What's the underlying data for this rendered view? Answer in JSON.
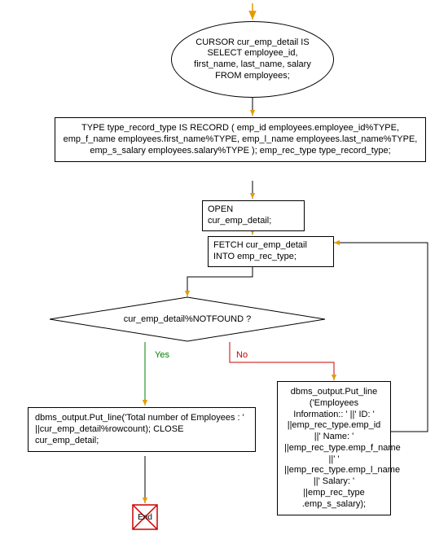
{
  "nodes": {
    "cursor": "CURSOR cur_emp_detail IS SELECT employee_id, first_name, last_name, salary FROM employees;",
    "type_record": "TYPE type_record_type IS RECORD ( emp_id employees.employee_id%TYPE, emp_f_name employees.first_name%TYPE, emp_l_name employees.last_name%TYPE, emp_s_salary employees.salary%TYPE ); emp_rec_type type_record_type;",
    "open": "OPEN cur_emp_detail;",
    "fetch": "FETCH cur_emp_detail INTO emp_rec_type;",
    "decision": "cur_emp_detail%NOTFOUND ?",
    "output_row": "dbms_output.Put_line ('Employees Information::  ' ||' ID: ' ||emp_rec_type.emp_id ||'   Name: ' ||emp_rec_type.emp_f_name ||' ' ||emp_rec_type.emp_l_name ||'   Salary: ' ||emp_rec_type .emp_s_salary);",
    "output_total": "dbms_output.Put_line('Total number of Employees : ' ||cur_emp_detail%rowcount); CLOSE cur_emp_detail;",
    "end": "End"
  },
  "edges": {
    "yes": "Yes",
    "no": "No"
  }
}
